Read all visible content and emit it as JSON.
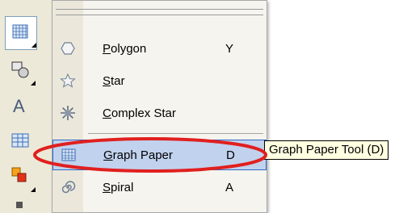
{
  "menu": {
    "items": [
      {
        "label_key": "P",
        "label_rest": "olygon",
        "shortcut": "Y",
        "icon": "polygon-icon"
      },
      {
        "label_key": "S",
        "label_rest": "tar",
        "shortcut": "",
        "icon": "star-icon"
      },
      {
        "label_key": "C",
        "label_rest": "omplex Star",
        "shortcut": "",
        "icon": "complex-star-icon"
      },
      {
        "label_key": "G",
        "label_rest": "raph Paper",
        "shortcut": "D",
        "icon": "graph-paper-icon",
        "selected": true
      },
      {
        "label_key": "S",
        "label_rest": "piral",
        "shortcut": "A",
        "icon": "spiral-icon"
      }
    ]
  },
  "tooltip": {
    "text": "Graph Paper Tool (D)"
  },
  "toolbox": {
    "tools": [
      "graph-paper-tool-icon",
      "shape-tool-icon",
      "text-tool-icon",
      "table-tool-icon",
      "interactive-tool-icon"
    ]
  },
  "colors": {
    "highlight": "#c1d2ee",
    "highlight_border": "#316ac5",
    "annotation": "#e0201f",
    "tooltip_bg": "#ffffe1"
  }
}
